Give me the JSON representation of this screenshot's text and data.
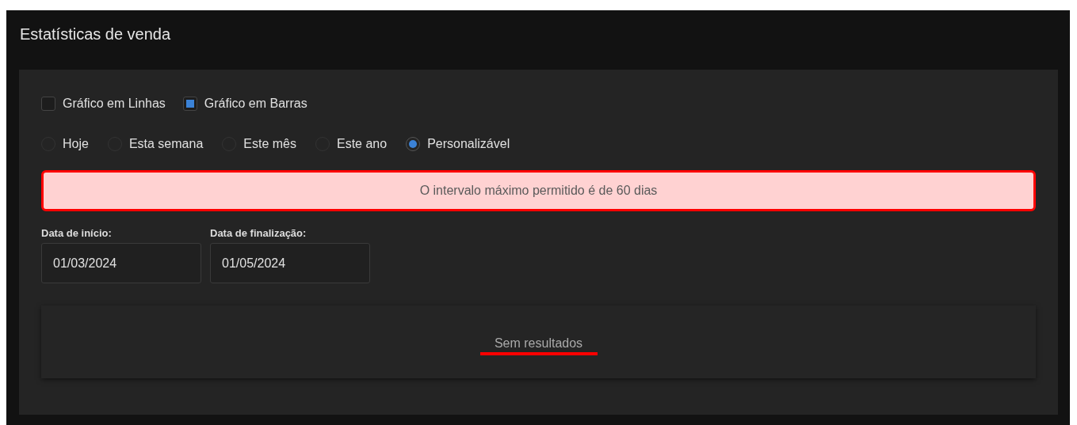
{
  "panel": {
    "title": "Estatísticas de venda"
  },
  "chart_types": [
    {
      "label": "Gráfico em Linhas",
      "checked": false
    },
    {
      "label": "Gráfico em Barras",
      "checked": true
    }
  ],
  "periods": [
    {
      "label": "Hoje",
      "selected": false
    },
    {
      "label": "Esta semana",
      "selected": false
    },
    {
      "label": "Este mês",
      "selected": false
    },
    {
      "label": "Este ano",
      "selected": false
    },
    {
      "label": "Personalizável",
      "selected": true
    }
  ],
  "alert": {
    "text": "O intervalo máximo permitido é de 60 dias"
  },
  "dates": [
    {
      "label": "Data de início:",
      "value": "01/03/2024"
    },
    {
      "label": "Data de finalização:",
      "value": "01/05/2024"
    }
  ],
  "results": {
    "text": "Sem resultados",
    "underlined": true
  }
}
